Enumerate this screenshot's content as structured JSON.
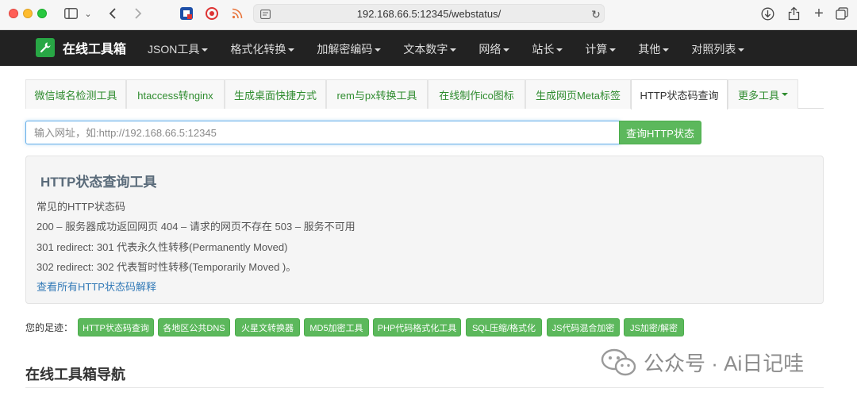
{
  "browser": {
    "url": "192.168.66.5:12345/webstatus/"
  },
  "navbar": {
    "brand": "在线工具箱",
    "items": [
      "JSON工具",
      "格式化转换",
      "加解密编码",
      "文本数字",
      "网络",
      "站长",
      "计算",
      "其他",
      "对照列表"
    ]
  },
  "tabs": [
    {
      "label": "微信域名检测工具",
      "active": false
    },
    {
      "label": "htaccess转nginx",
      "active": false
    },
    {
      "label": "生成桌面快捷方式",
      "active": false
    },
    {
      "label": "rem与px转换工具",
      "active": false
    },
    {
      "label": "在线制作ico图标",
      "active": false
    },
    {
      "label": "生成网页Meta标签",
      "active": false
    },
    {
      "label": "HTTP状态码查询",
      "active": true
    },
    {
      "label": "更多工具",
      "active": false
    }
  ],
  "query": {
    "placeholder": "输入网址，如:http://192.168.66.5:12345",
    "value": "",
    "button": "查询HTTP状态"
  },
  "panel": {
    "title": "HTTP状态查询工具",
    "lines": [
      "常见的HTTP状态码",
      "200 – 服务器成功返回网页 404 – 请求的网页不存在 503 – 服务不可用",
      "301 redirect: 301 代表永久性转移(Permanently Moved)",
      "302 redirect: 302 代表暂时性转移(Temporarily Moved )。"
    ],
    "link": "查看所有HTTP状态码解释"
  },
  "footprint": {
    "label": "您的足迹：",
    "items": [
      "HTTP状态码查询",
      "各地区公共DNS",
      "火星文转换器",
      "MD5加密工具",
      "PHP代码格式化工具",
      "SQL压缩/格式化",
      "JS代码混合加密",
      "JS加密/解密"
    ]
  },
  "section": {
    "title": "在线工具箱导航"
  },
  "watermark": {
    "text": "公众号 · Ai日记哇"
  },
  "colors": {
    "accent_green": "#5cb85c",
    "navbar_bg": "#222222",
    "link_blue": "#337ab7"
  }
}
